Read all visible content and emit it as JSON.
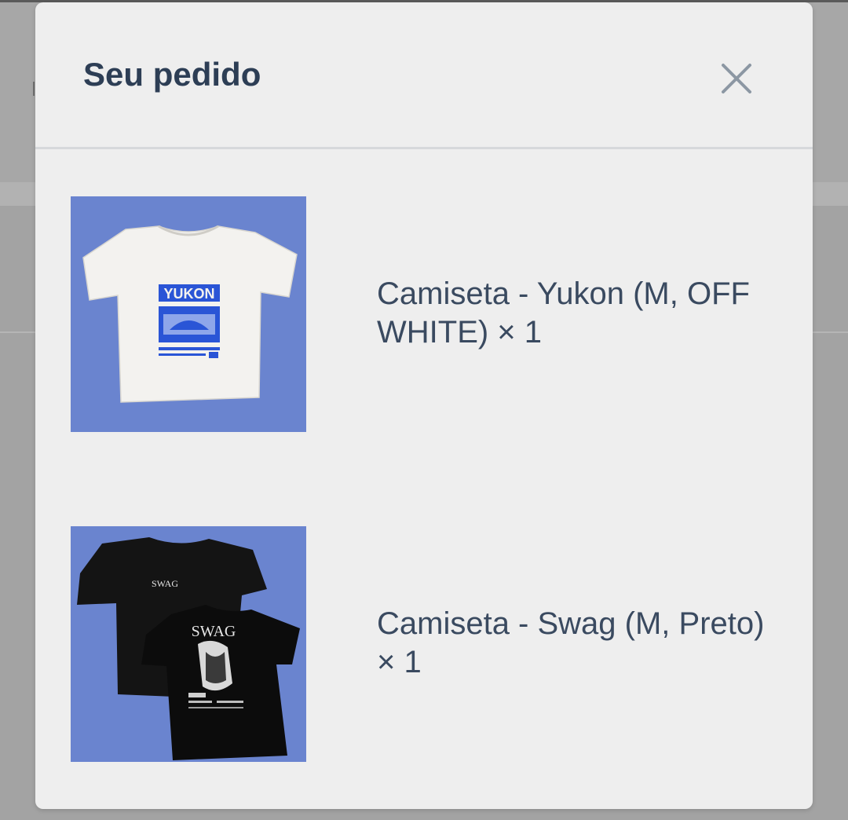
{
  "modal": {
    "title": "Seu pedido",
    "close_icon": "close-icon"
  },
  "items": [
    {
      "description": "Camiseta - Yukon (M, OFF WHITE) × 1",
      "thumbnail": {
        "icon": "white-tshirt-image",
        "print_text": "YUKON",
        "background": "#6a84cf",
        "shirt_color": "#f3f2ef",
        "print_color": "#2a55d6"
      }
    },
    {
      "description": "Camiseta - Swag (M, Preto) × 1",
      "thumbnail": {
        "icon": "black-tshirt-image",
        "print_text": "SWAG",
        "background": "#6a84cf",
        "shirt_color": "#111111",
        "print_color": "#e6e6e6"
      }
    }
  ],
  "colors": {
    "modal_background": "#eeeeee",
    "title_text": "#2d3e55",
    "item_text": "#3a4a60",
    "overlay": "#a6a6a6"
  }
}
